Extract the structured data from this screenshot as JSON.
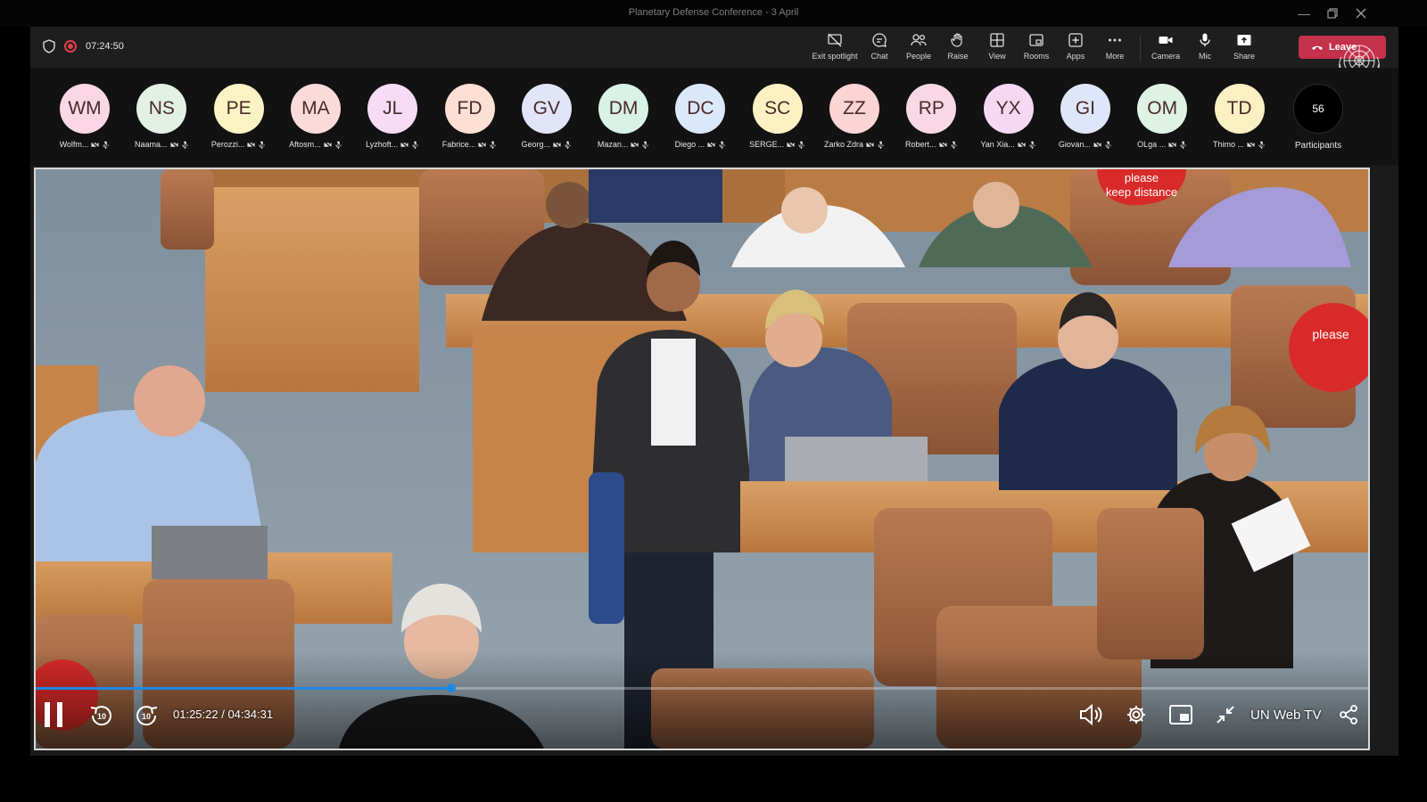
{
  "window": {
    "title": "Planetary Defense Conference - 3 April",
    "controls": [
      "minimize",
      "restore",
      "close"
    ]
  },
  "meeting": {
    "recording_time": "07:24:50",
    "toolbar": [
      {
        "id": "exit-spotlight",
        "label": "Exit spotlight"
      },
      {
        "id": "chat",
        "label": "Chat"
      },
      {
        "id": "people",
        "label": "People"
      },
      {
        "id": "raise",
        "label": "Raise"
      },
      {
        "id": "view",
        "label": "View"
      },
      {
        "id": "rooms",
        "label": "Rooms"
      },
      {
        "id": "apps",
        "label": "Apps"
      },
      {
        "id": "more",
        "label": "More"
      },
      {
        "id": "camera",
        "label": "Camera"
      },
      {
        "id": "mic",
        "label": "Mic"
      },
      {
        "id": "share",
        "label": "Share"
      }
    ],
    "leave_label": "Leave",
    "participants": [
      {
        "initials": "WM",
        "name": "Wolfm...",
        "color": "#fbd7e6"
      },
      {
        "initials": "NS",
        "name": "Naama...",
        "color": "#e3f1e4"
      },
      {
        "initials": "PE",
        "name": "Perozzi...",
        "color": "#fbf3c4"
      },
      {
        "initials": "MA",
        "name": "Aftosm...",
        "color": "#fbdada"
      },
      {
        "initials": "JL",
        "name": "Lyzhoft...",
        "color": "#f6dcf4"
      },
      {
        "initials": "FD",
        "name": "Fabrice...",
        "color": "#fde0d4"
      },
      {
        "initials": "GV",
        "name": "Georg...",
        "color": "#e2e4f8"
      },
      {
        "initials": "DM",
        "name": "Mazan...",
        "color": "#d9f1e6"
      },
      {
        "initials": "DC",
        "name": "Diego ...",
        "color": "#dbe8fa"
      },
      {
        "initials": "SC",
        "name": "SERGE...",
        "color": "#fdf1c4"
      },
      {
        "initials": "ZZ",
        "name": "Zarko Zdra...",
        "color": "#fbd4d4"
      },
      {
        "initials": "RP",
        "name": "Robert...",
        "color": "#f9d8e6"
      },
      {
        "initials": "YX",
        "name": "Yan Xia...",
        "color": "#f6d8f3"
      },
      {
        "initials": "GI",
        "name": "Giovan...",
        "color": "#e0e6f9"
      },
      {
        "initials": "OM",
        "name": "OLga ...",
        "color": "#dff2e3"
      },
      {
        "initials": "TD",
        "name": "Thimo ...",
        "color": "#fbf0c2"
      }
    ],
    "participant_count": "56",
    "participants_label": "Participants"
  },
  "player": {
    "current_time": "01:25:22",
    "duration": "04:34:31",
    "time_display": "01:25:22 / 04:34:31",
    "progress_fraction": 0.312,
    "brand": "UN Web TV",
    "skip_back_label": "10",
    "skip_forward_label": "10",
    "sign_texts": [
      "please",
      "keep distance"
    ],
    "accent": "#1e88e5"
  }
}
